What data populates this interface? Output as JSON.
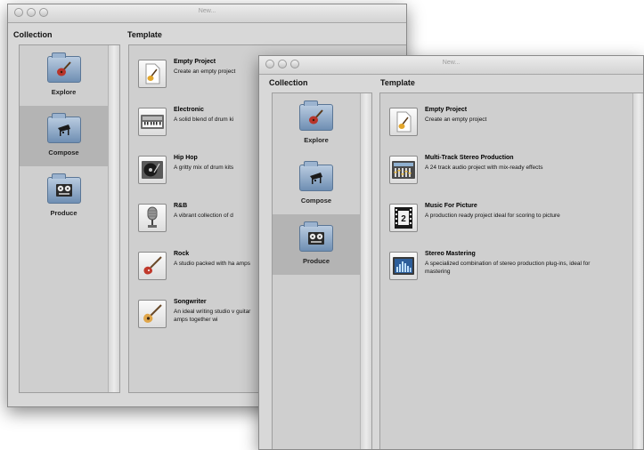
{
  "back_window": {
    "title": "New...",
    "collection_header": "Collection",
    "template_header": "Template",
    "collections": [
      {
        "label": "Explore",
        "icon": "guitar-icon"
      },
      {
        "label": "Compose",
        "icon": "piano-icon",
        "selected": true
      },
      {
        "label": "Produce",
        "icon": "tape-deck-icon"
      }
    ],
    "templates": [
      {
        "name": "Empty Project",
        "desc": "Create an empty project",
        "icon": "document-guitar-icon"
      },
      {
        "name": "Electronic",
        "desc": "A solid blend of drum ki",
        "icon": "synthesizer-icon"
      },
      {
        "name": "Hip Hop",
        "desc": "A gritty mix of drum kits",
        "icon": "turntable-icon"
      },
      {
        "name": "R&B",
        "desc": "A vibrant collection of d",
        "icon": "microphone-icon"
      },
      {
        "name": "Rock",
        "desc": "A studio packed with ha amps",
        "icon": "electric-guitar-icon"
      },
      {
        "name": "Songwriter",
        "desc": "An ideal writing studio v guitar amps together wi",
        "icon": "acoustic-guitar-icon"
      }
    ]
  },
  "front_window": {
    "title": "New...",
    "collection_header": "Collection",
    "template_header": "Template",
    "collections": [
      {
        "label": "Explore",
        "icon": "guitar-icon"
      },
      {
        "label": "Compose",
        "icon": "piano-icon"
      },
      {
        "label": "Produce",
        "icon": "tape-deck-icon",
        "selected": true
      }
    ],
    "templates": [
      {
        "name": "Empty Project",
        "desc": "Create an empty project",
        "icon": "document-guitar-icon"
      },
      {
        "name": "Multi-Track Stereo Production",
        "desc": "A 24 track audio project with mix-ready effects",
        "icon": "mixing-console-icon"
      },
      {
        "name": "Music For Picture",
        "desc": "A production ready project ideal for scoring to picture",
        "icon": "film-strip-icon",
        "icon_text": "2"
      },
      {
        "name": "Stereo Mastering",
        "desc": "A specialized combination of stereo production plug-ins, ideal for mastering",
        "icon": "meter-display-icon"
      }
    ]
  }
}
